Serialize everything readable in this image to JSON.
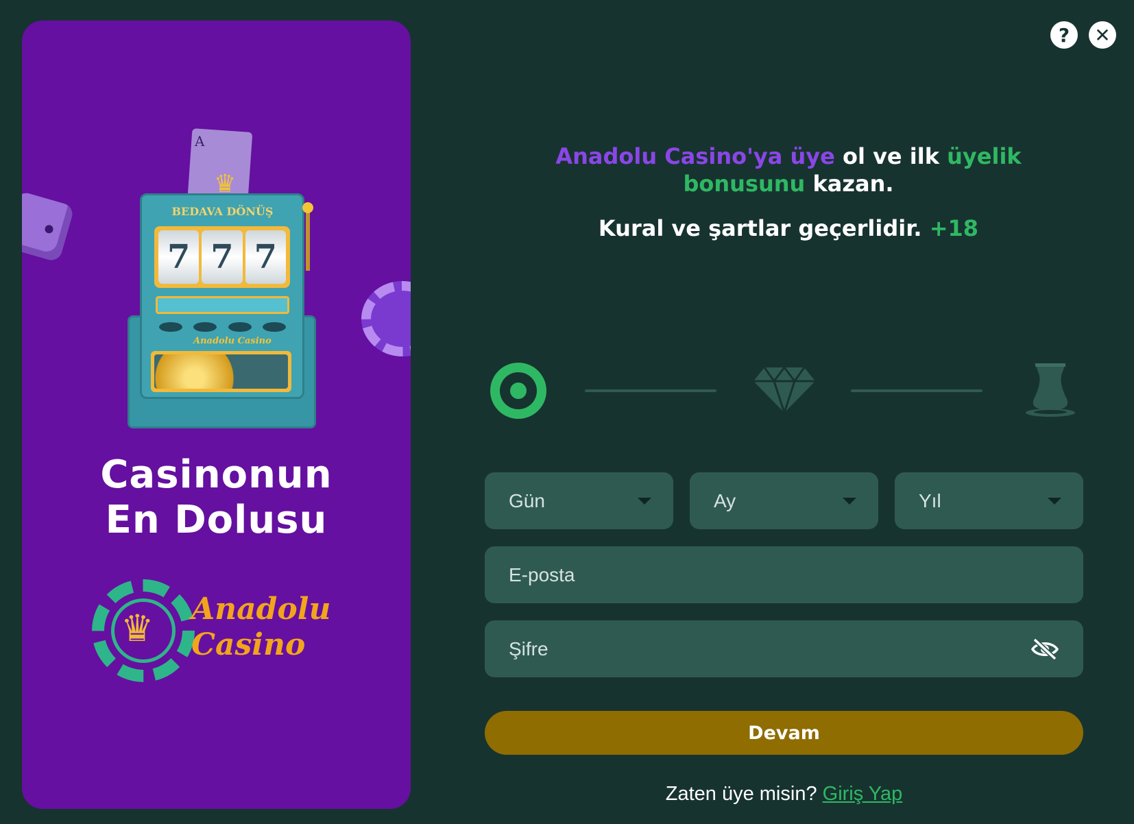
{
  "promo": {
    "title_line1": "Casinonun",
    "title_line2": "En Dolusu",
    "slot_sign": "BEDAVA DÖNÜŞ",
    "reels": [
      "7",
      "7",
      "7"
    ],
    "card_rank": "A",
    "brand_line1": "Anadolu",
    "brand_line2": "Casino",
    "mini_brand": "Anadolu Casino"
  },
  "top_icons": {
    "help": "?",
    "close": "✕"
  },
  "headline": {
    "part1": "Anadolu Casino'ya üye",
    "part2": " ol ve ilk ",
    "part3": "üyelik bonusunu",
    "part4": " kazan.",
    "terms": "Kural ve şartlar geçerlidir. ",
    "age": "+18"
  },
  "stepper": {
    "steps": [
      "target-icon",
      "diamond-icon",
      "tea-glass-icon"
    ],
    "active_step": 1,
    "active_color": "#2fb863",
    "inactive_color": "#2f5a52"
  },
  "form": {
    "day_label": "Gün",
    "month_label": "Ay",
    "year_label": "Yıl",
    "email_placeholder": "E-posta",
    "password_placeholder": "Şifre",
    "continue_label": "Devam"
  },
  "footer": {
    "prompt": "Zaten üye misin? ",
    "login_label": "Giriş Yap"
  },
  "colors": {
    "background": "#173330",
    "promo": "#6510a0",
    "field": "#2f5a52",
    "button": "#8f6d00",
    "accent_green": "#2fb863",
    "accent_purple": "#8b46e6"
  }
}
